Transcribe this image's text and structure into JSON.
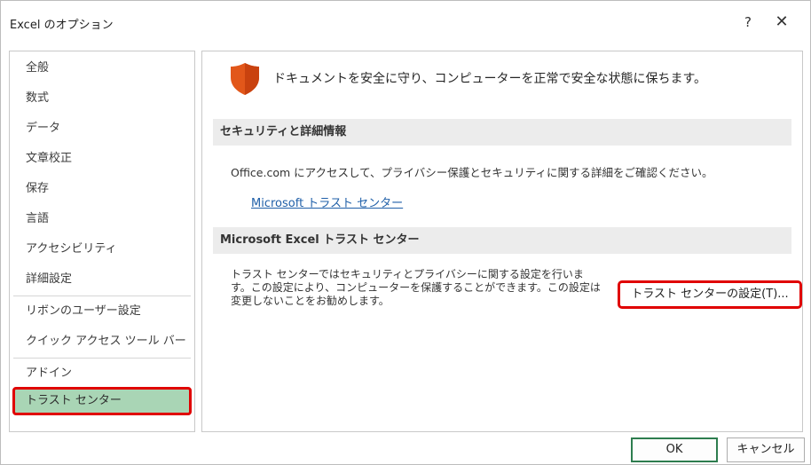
{
  "window": {
    "title": "Excel のオプション",
    "help_label": "?",
    "close_label": "✕"
  },
  "nav": {
    "items": [
      {
        "label": "全般"
      },
      {
        "label": "数式"
      },
      {
        "label": "データ"
      },
      {
        "label": "文章校正"
      },
      {
        "label": "保存"
      },
      {
        "label": "言語"
      },
      {
        "label": "アクセシビリティ"
      },
      {
        "label": "詳細設定"
      },
      {
        "label": "リボンのユーザー設定"
      },
      {
        "label": "クイック アクセス ツール バー"
      },
      {
        "label": "アドイン"
      },
      {
        "label": "トラスト センター"
      }
    ],
    "selected_index": 11
  },
  "main": {
    "headline": "ドキュメントを安全に守り、コンピューターを正常で安全な状態に保ちます。",
    "privacy_section": {
      "title": "セキュリティと詳細情報",
      "description": "Office.com にアクセスして、プライバシー保護とセキュリティに関する詳細をご確認ください。",
      "link_label": "Microsoft トラスト センター"
    },
    "trust_section": {
      "title": "Microsoft Excel トラスト センター",
      "description": "トラスト センターではセキュリティとプライバシーに関する設定を行います。この設定により、コンピューターを保護することができます。この設定は変更しないことをお勧めします。",
      "button_label": "トラスト センターの設定(T)..."
    }
  },
  "footer": {
    "ok_label": "OK",
    "cancel_label": "キャンセル"
  },
  "colors": {
    "selected_bg": "#a9d5b5",
    "highlight_border": "#e00000",
    "shield": "#e2571a",
    "link": "#1f5fa8"
  },
  "icons": {
    "shield": "shield-icon",
    "help": "help-icon",
    "close": "close-icon"
  }
}
